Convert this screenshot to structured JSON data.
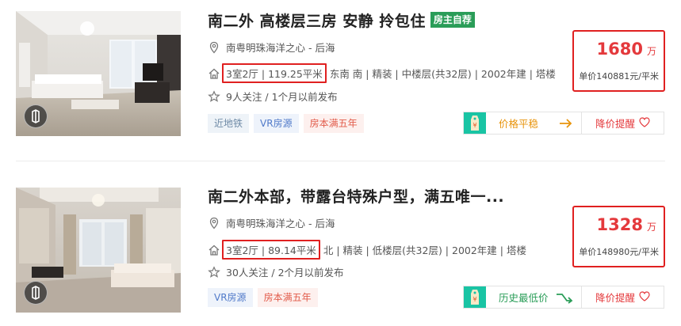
{
  "listings": [
    {
      "title": "南二外 高楼层三房 安静 拎包住",
      "owner_badge": "房主自荐",
      "location": "南粤明珠海洋之心 - 后海",
      "layout_area": "3室2厅 | 119.25平米",
      "details": "东南 南 | 精装 | 中楼层(共32层) | 2002年建 | 塔楼",
      "follow": "9人关注 / 1个月以前发布",
      "tags": [
        "近地铁",
        "VR房源",
        "房本满五年"
      ],
      "price_total": "1680",
      "price_total_unit": "万",
      "price_per_sqm": "单价140881元/平米",
      "trend_label": "价格平稳",
      "remind_label": "降价提醒"
    },
    {
      "title": "南二外本部，带露台特殊户型，满五唯一...",
      "owner_badge": "",
      "location": "南粤明珠海洋之心 - 后海",
      "layout_area": "3室2厅 | 89.14平米",
      "details": "北 | 精装 | 低楼层(共32层) | 2002年建 | 塔楼",
      "follow": "30人关注 / 2个月以前发布",
      "tags": [
        "VR房源",
        "房本满五年"
      ],
      "price_total": "1328",
      "price_total_unit": "万",
      "price_per_sqm": "单价148980元/平米",
      "trend_label": "历史最低价",
      "remind_label": "降价提醒"
    }
  ],
  "colors": {
    "price_red": "#e4393c",
    "highlight_box": "#e02020",
    "owner_badge_bg": "#2a9d58",
    "trend_orange": "#e8940c",
    "trend_green": "#2a9d58"
  },
  "icons": [
    "location-pin-icon",
    "house-icon",
    "star-icon",
    "vr-icon",
    "price-tag-icon",
    "arrow-right-icon",
    "trend-down-icon",
    "heart-icon"
  ]
}
